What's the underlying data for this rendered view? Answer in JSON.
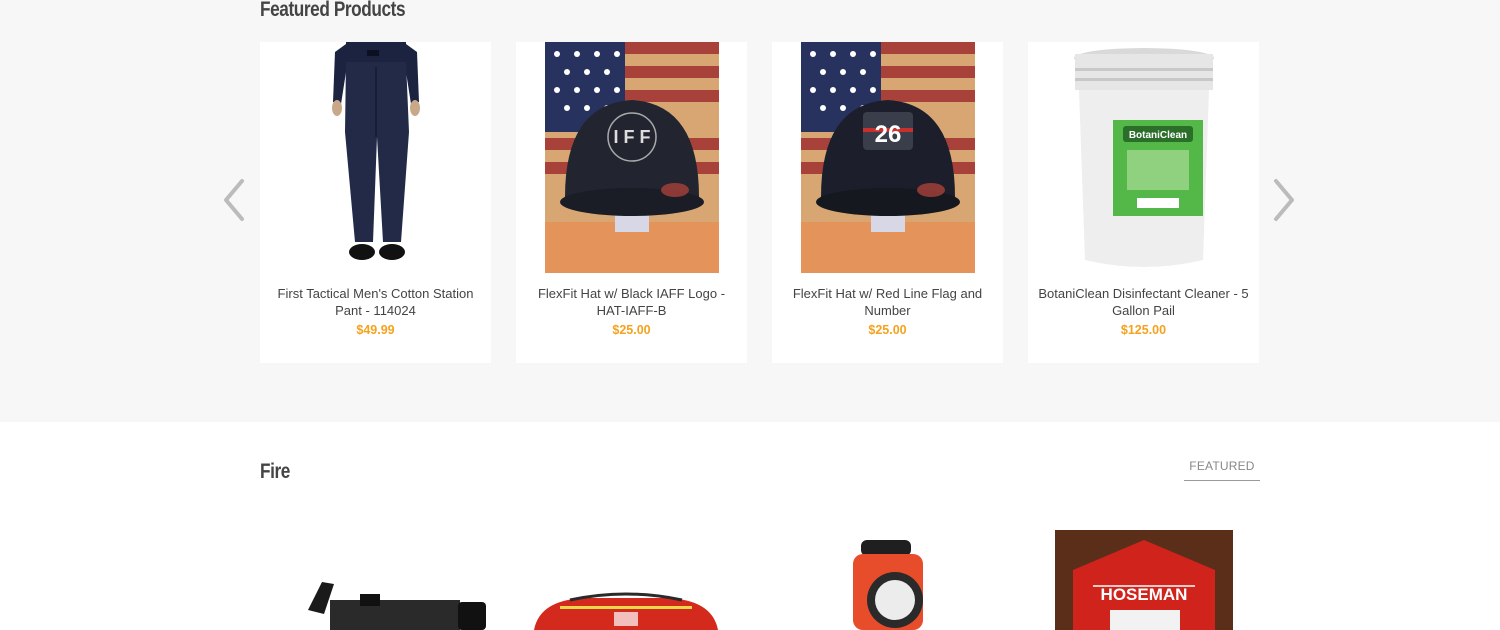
{
  "featured": {
    "title": "Featured Products",
    "products": [
      {
        "name": "First Tactical Men's Cotton Station Pant - 114024",
        "price": "$49.99",
        "image": "navy-pants"
      },
      {
        "name": "FlexFit Hat w/ Black IAFF Logo - HAT-IAFF-B",
        "price": "$25.00",
        "image": "black-hat-iaff"
      },
      {
        "name": "FlexFit Hat w/ Red Line Flag and Number",
        "price": "$25.00",
        "image": "black-hat-flag-26"
      },
      {
        "name": "BotaniClean Disinfectant Cleaner - 5 Gallon Pail",
        "price": "$125.00",
        "image": "white-pail"
      }
    ],
    "hat_iaff_text": "I F F",
    "hat_number": "26",
    "pail_brand": "BotaniClean"
  },
  "fire": {
    "title": "Fire",
    "tab_label": "FEATURED",
    "plaque_text": "HOSEMAN"
  },
  "colors": {
    "price": "#f5a21c",
    "section_bg": "#f7f7f7",
    "title": "#444444"
  }
}
